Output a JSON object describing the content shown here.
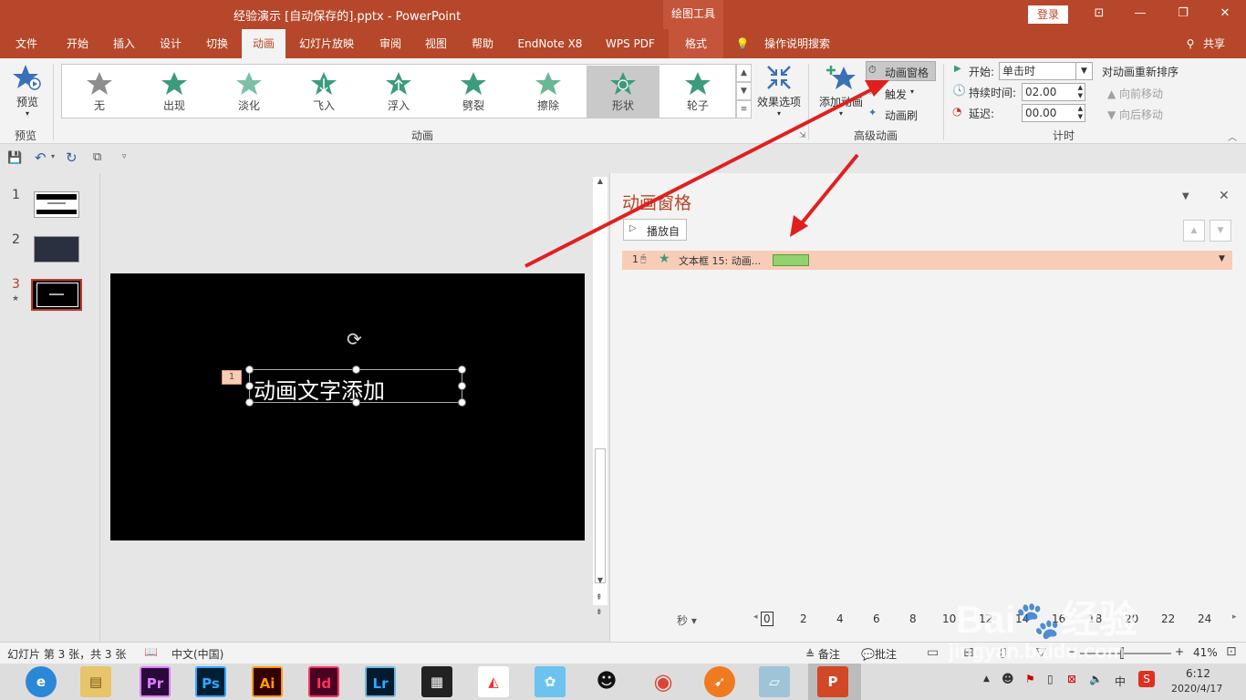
{
  "window": {
    "title": "经验演示 [自动保存的].pptx  -  PowerPoint",
    "context_tool": "绘图工具",
    "login": "登录",
    "buttons": [
      "restore-icon",
      "minimize-icon",
      "maximize-icon",
      "close-icon"
    ]
  },
  "tabs": [
    {
      "label": "文件"
    },
    {
      "label": "开始"
    },
    {
      "label": "插入"
    },
    {
      "label": "设计"
    },
    {
      "label": "切换"
    },
    {
      "label": "动画",
      "active": true
    },
    {
      "label": "幻灯片放映"
    },
    {
      "label": "审阅"
    },
    {
      "label": "视图"
    },
    {
      "label": "帮助"
    },
    {
      "label": "EndNote X8"
    },
    {
      "label": "WPS PDF"
    },
    {
      "label": "格式"
    }
  ],
  "tell_me": "操作说明搜索",
  "share": "共享",
  "ribbon": {
    "preview": {
      "button": "预览",
      "group": "预览"
    },
    "animations": {
      "items": [
        "无",
        "出现",
        "淡化",
        "飞入",
        "浮入",
        "劈裂",
        "擦除",
        "形状",
        "轮子"
      ],
      "selected": "形状",
      "effect_options": "效果选项",
      "group": "动画"
    },
    "advanced": {
      "add_animation": "添加动画",
      "pane": "动画窗格",
      "trigger": "触发",
      "painter": "动画刷",
      "group": "高级动画"
    },
    "timing": {
      "start_label": "开始:",
      "start_value": "单击时",
      "duration_label": "持续时间:",
      "duration_value": "02.00",
      "delay_label": "延迟:",
      "delay_value": "00.00",
      "reorder": "对动画重新排序",
      "move_earlier": "向前移动",
      "move_later": "向后移动",
      "group": "计时"
    }
  },
  "slides": [
    {
      "num": "1"
    },
    {
      "num": "2"
    },
    {
      "num": "3",
      "active": true,
      "star": "★"
    }
  ],
  "slide": {
    "text": "动画文字添加",
    "tag": "1"
  },
  "anim_pane": {
    "title": "动画窗格",
    "play_from": "播放自",
    "item": {
      "num": "1",
      "label": "文本框 15: 动画..."
    },
    "timeline_unit": "秒",
    "ticks": [
      "0",
      "2",
      "4",
      "6",
      "8",
      "10",
      "12",
      "14",
      "16",
      "18",
      "20",
      "22",
      "24"
    ]
  },
  "status": {
    "slide_info": "幻灯片 第 3 张，共 3 张",
    "language": "中文(中国)",
    "notes": "备注",
    "comments": "批注",
    "zoom": "41%"
  },
  "taskbar": {
    "apps": [
      "Pr",
      "Ps",
      "Ai",
      "Id",
      "Lr"
    ],
    "time": "6:12",
    "date": "2020/4/17",
    "ime": "中"
  },
  "watermark": {
    "brand": "Bai",
    "brand2": "经验",
    "url": "jingyan.baidu.com"
  },
  "colors": {
    "accent": "#b7472a",
    "highlight": "#f8cdb8",
    "bar": "#92d36e",
    "arrow": "#e02020"
  }
}
